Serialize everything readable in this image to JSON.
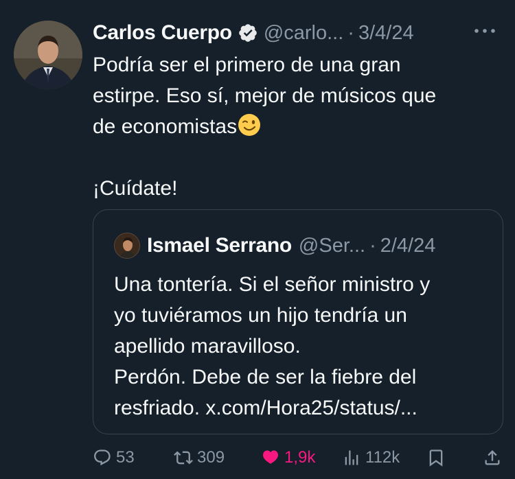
{
  "tweet": {
    "author": {
      "display_name": "Carlos Cuerpo",
      "handle": "@carlo...",
      "verified": true
    },
    "separator": "·",
    "date": "3/4/24",
    "text": "Podría ser el primero de una gran\nestirpe. Eso sí, mejor de músicos que\nde economistas",
    "text_after_emoji": "\n\n¡Cuídate!",
    "emoji": "winking-face"
  },
  "quoted_tweet": {
    "author": {
      "display_name": "Ismael Serrano",
      "handle": "@Ser..."
    },
    "separator": "·",
    "date": "2/4/24",
    "text": "Una tontería. Si el señor ministro y\nyo tuviéramos un hijo tendría un\napellido maravilloso.\nPerdón. Debe de ser la fiebre del\nresfriado. x.com/Hora25/status/..."
  },
  "actions": {
    "replies": "53",
    "reposts": "309",
    "likes": "1,9k",
    "views": "112k"
  },
  "colors": {
    "background": "#15202b",
    "text": "#f7f9f9",
    "secondary": "#8b98a5",
    "border": "#38444d",
    "like": "#f91880",
    "verified_badge": "#e7e9ea"
  }
}
